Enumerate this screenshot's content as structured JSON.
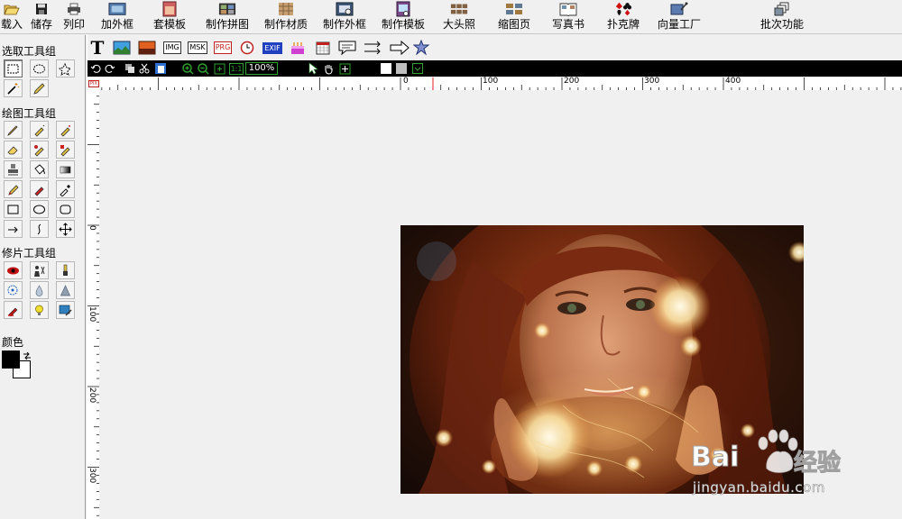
{
  "toolbar": {
    "items": [
      {
        "label": "载入",
        "icon": "folder-open-icon"
      },
      {
        "label": "储存",
        "icon": "save-disk-icon"
      },
      {
        "label": "列印",
        "icon": "printer-icon"
      },
      {
        "label": "加外框",
        "icon": "frame-icon"
      },
      {
        "label": "套模板",
        "icon": "template-icon"
      },
      {
        "label": "制作拼图",
        "icon": "collage-icon"
      },
      {
        "label": "制作材质",
        "icon": "texture-icon"
      },
      {
        "label": "制作外框",
        "icon": "make-frame-icon"
      },
      {
        "label": "制作模板",
        "icon": "make-template-icon"
      },
      {
        "label": "大头照",
        "icon": "id-photo-icon"
      },
      {
        "label": "缩图页",
        "icon": "thumbnail-icon"
      },
      {
        "label": "写真书",
        "icon": "photo-book-icon"
      },
      {
        "label": "扑克牌",
        "icon": "poker-cards-icon"
      },
      {
        "label": "向量工厂",
        "icon": "vector-factory-icon"
      },
      {
        "label": "批次功能",
        "icon": "batch-icon"
      }
    ]
  },
  "left_panel": {
    "select_group_title": "选取工具组",
    "draw_group_title": "绘图工具组",
    "retouch_group_title": "修片工具组",
    "color_title": "颜色",
    "fg_color": "#000000",
    "bg_color": "#ffffff"
  },
  "sec_toolbar": {
    "text_tool_glyph": "T",
    "img_label": "IMG",
    "msk_label": "MSK",
    "prg_label": "PRG",
    "exif_label": "EXIF"
  },
  "image_toolbar": {
    "zoom": "100%",
    "actual_size_label": "1:1"
  },
  "ruler": {
    "h_labels": [
      "0",
      "100",
      "200",
      "300",
      "400"
    ],
    "v_labels": [
      "0",
      "100",
      "200",
      "300"
    ]
  },
  "watermark": {
    "brand": "Bai",
    "brand_cn": "经验",
    "url": "jingyan.baidu.com"
  },
  "colors": {
    "accent_green": "#2ea02e",
    "ruler_marker": "#e02020"
  }
}
